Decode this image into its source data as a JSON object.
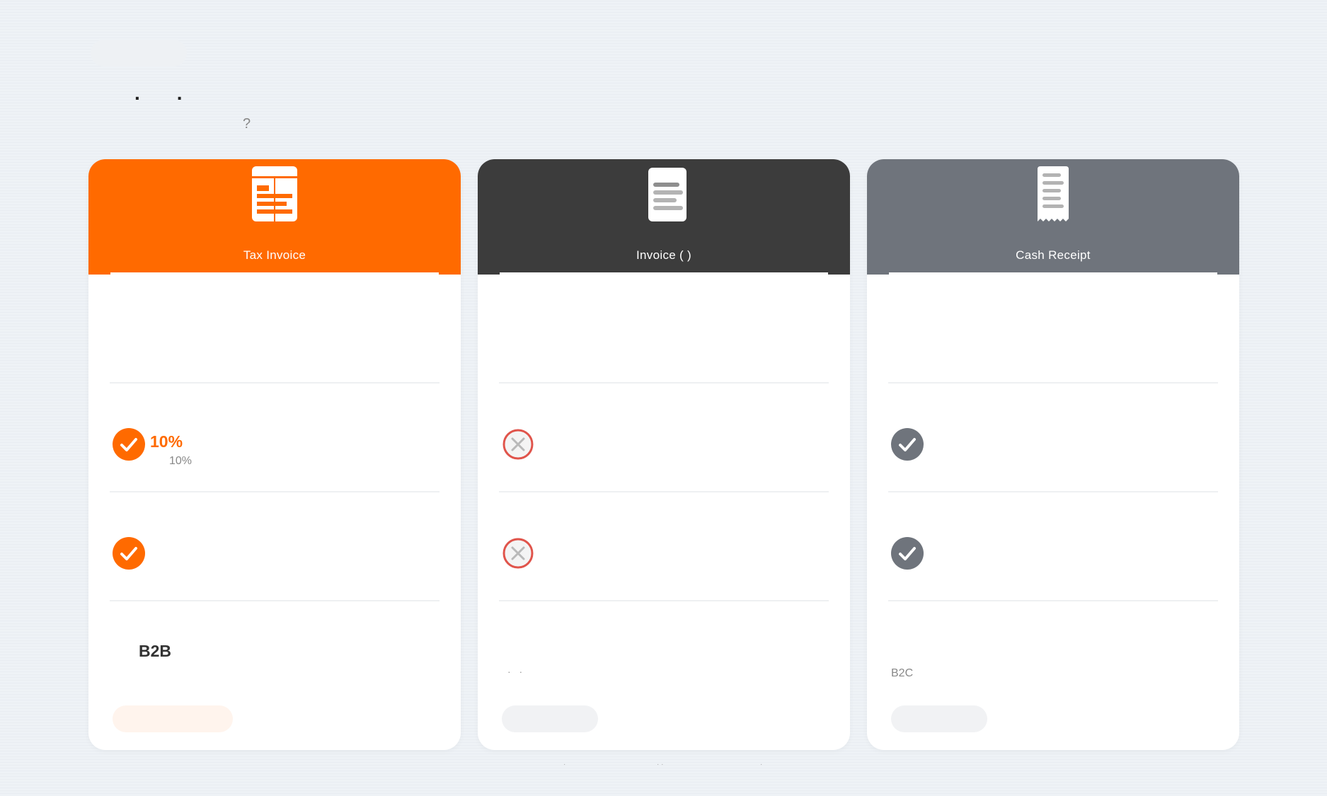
{
  "page": {
    "heading_marks": "..",
    "subtitle": "?",
    "footer_marks": [
      "·",
      "· ·",
      "·"
    ]
  },
  "colors": {
    "orange": "#ff6a00",
    "dark": "#3c3c3c",
    "gray": "#6f747c",
    "error": "#e0544b"
  },
  "cards": [
    {
      "title": "Tax Invoice",
      "icon": "tax-invoice-icon",
      "row1": "",
      "row2_status": "check",
      "row2_value": "10%",
      "row2_note": "10%",
      "row3_status": "check",
      "bottom_text": "B2B",
      "button_label": ""
    },
    {
      "title": "Invoice (  )",
      "icon": "invoice-icon",
      "row1": "",
      "row2_status": "cross",
      "row3_status": "cross",
      "bottom_text": "· ·",
      "button_label": ""
    },
    {
      "title": "Cash Receipt",
      "icon": "receipt-icon",
      "row1": "",
      "row2_status": "check",
      "row3_status": "check",
      "bottom_text": "B2C",
      "button_label": ""
    }
  ]
}
